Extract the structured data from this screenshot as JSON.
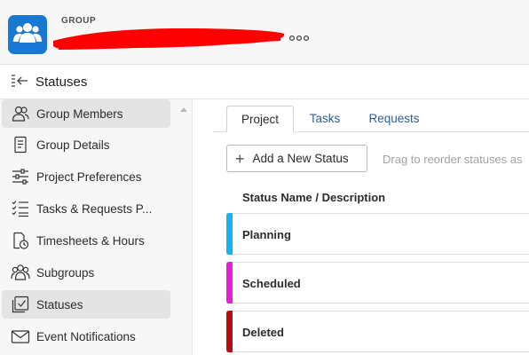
{
  "header": {
    "kicker": "GROUP",
    "more_icon": "ellipsis-icon",
    "colors": {
      "avatar_bg": "#1a78d2",
      "redaction": "#ff0000"
    }
  },
  "subheader": {
    "title": "Statuses",
    "icon": "collapse-panel-icon"
  },
  "sidebar": {
    "items": [
      {
        "label": "Group Members",
        "icon": "group-members-icon",
        "active": true
      },
      {
        "label": "Group Details",
        "icon": "document-icon",
        "active": false
      },
      {
        "label": "Project Preferences",
        "icon": "sliders-icon",
        "active": false
      },
      {
        "label": "Tasks & Requests P...",
        "icon": "checklist-icon",
        "active": false
      },
      {
        "label": "Timesheets & Hours",
        "icon": "timesheet-icon",
        "active": false
      },
      {
        "label": "Subgroups",
        "icon": "subgroups-icon",
        "active": false
      },
      {
        "label": "Statuses",
        "icon": "checkbox-list-icon",
        "active": true
      },
      {
        "label": "Event Notifications",
        "icon": "envelope-icon",
        "active": false
      }
    ]
  },
  "tabs": [
    {
      "label": "Project",
      "active": true
    },
    {
      "label": "Tasks",
      "active": false
    },
    {
      "label": "Requests",
      "active": false
    }
  ],
  "toolbar": {
    "add_label": "Add a New Status",
    "drag_hint": "Drag to reorder statuses as"
  },
  "table": {
    "column_header": "Status Name / Description",
    "rows": [
      {
        "name": "Planning",
        "color": "#16b3ef"
      },
      {
        "name": "Scheduled",
        "color": "#e51fd6"
      },
      {
        "name": "Deleted",
        "color": "#b90d0d"
      }
    ]
  }
}
